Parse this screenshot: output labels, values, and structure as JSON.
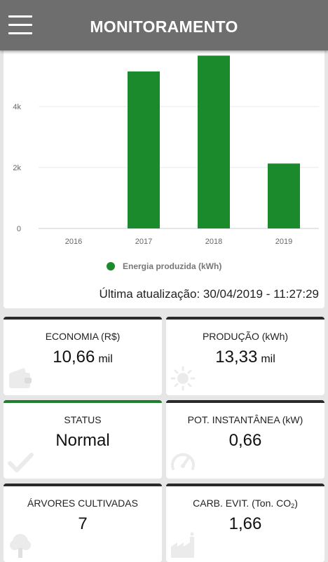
{
  "header": {
    "title": "MONITORAMENTO",
    "menu_icon": "hamburger-icon"
  },
  "chart_data": {
    "type": "bar",
    "categories": [
      "2016",
      "2017",
      "2018",
      "2019"
    ],
    "series": [
      {
        "name": "Energia produzida (kWh)",
        "values": [
          0,
          5150,
          5670,
          2130
        ]
      }
    ],
    "yticks": [
      "0",
      "2k",
      "4k"
    ],
    "ylim": [
      0,
      6000
    ],
    "grid": true,
    "legend_position": "bottom",
    "bar_color": "#1a8a2c"
  },
  "last_update": "Última atualização: 30/04/2019 - 11:27:29",
  "cards": [
    {
      "label": "ECONOMIA (R$)",
      "value": "10,66",
      "unit": "mil",
      "icon": "wallet-icon"
    },
    {
      "label": "PRODUÇÃO (kWh)",
      "value": "13,33",
      "unit": "mil",
      "icon": "sun-icon"
    },
    {
      "label": "STATUS",
      "value": "Normal",
      "icon": "checkmark-icon",
      "accent": "#1e7e2e"
    },
    {
      "label": "POT. INSTANTÂNEA (kW)",
      "value": "0,66",
      "icon": "gauge-icon"
    },
    {
      "label": "ÁRVORES CULTIVADAS",
      "value": "7",
      "icon": "tree-icon"
    },
    {
      "label_prefix": "CARB. EVIT. (Ton. CO",
      "label_sub": "2",
      "label_suffix": ")",
      "value": "1,66",
      "icon": "factory-icon"
    }
  ]
}
